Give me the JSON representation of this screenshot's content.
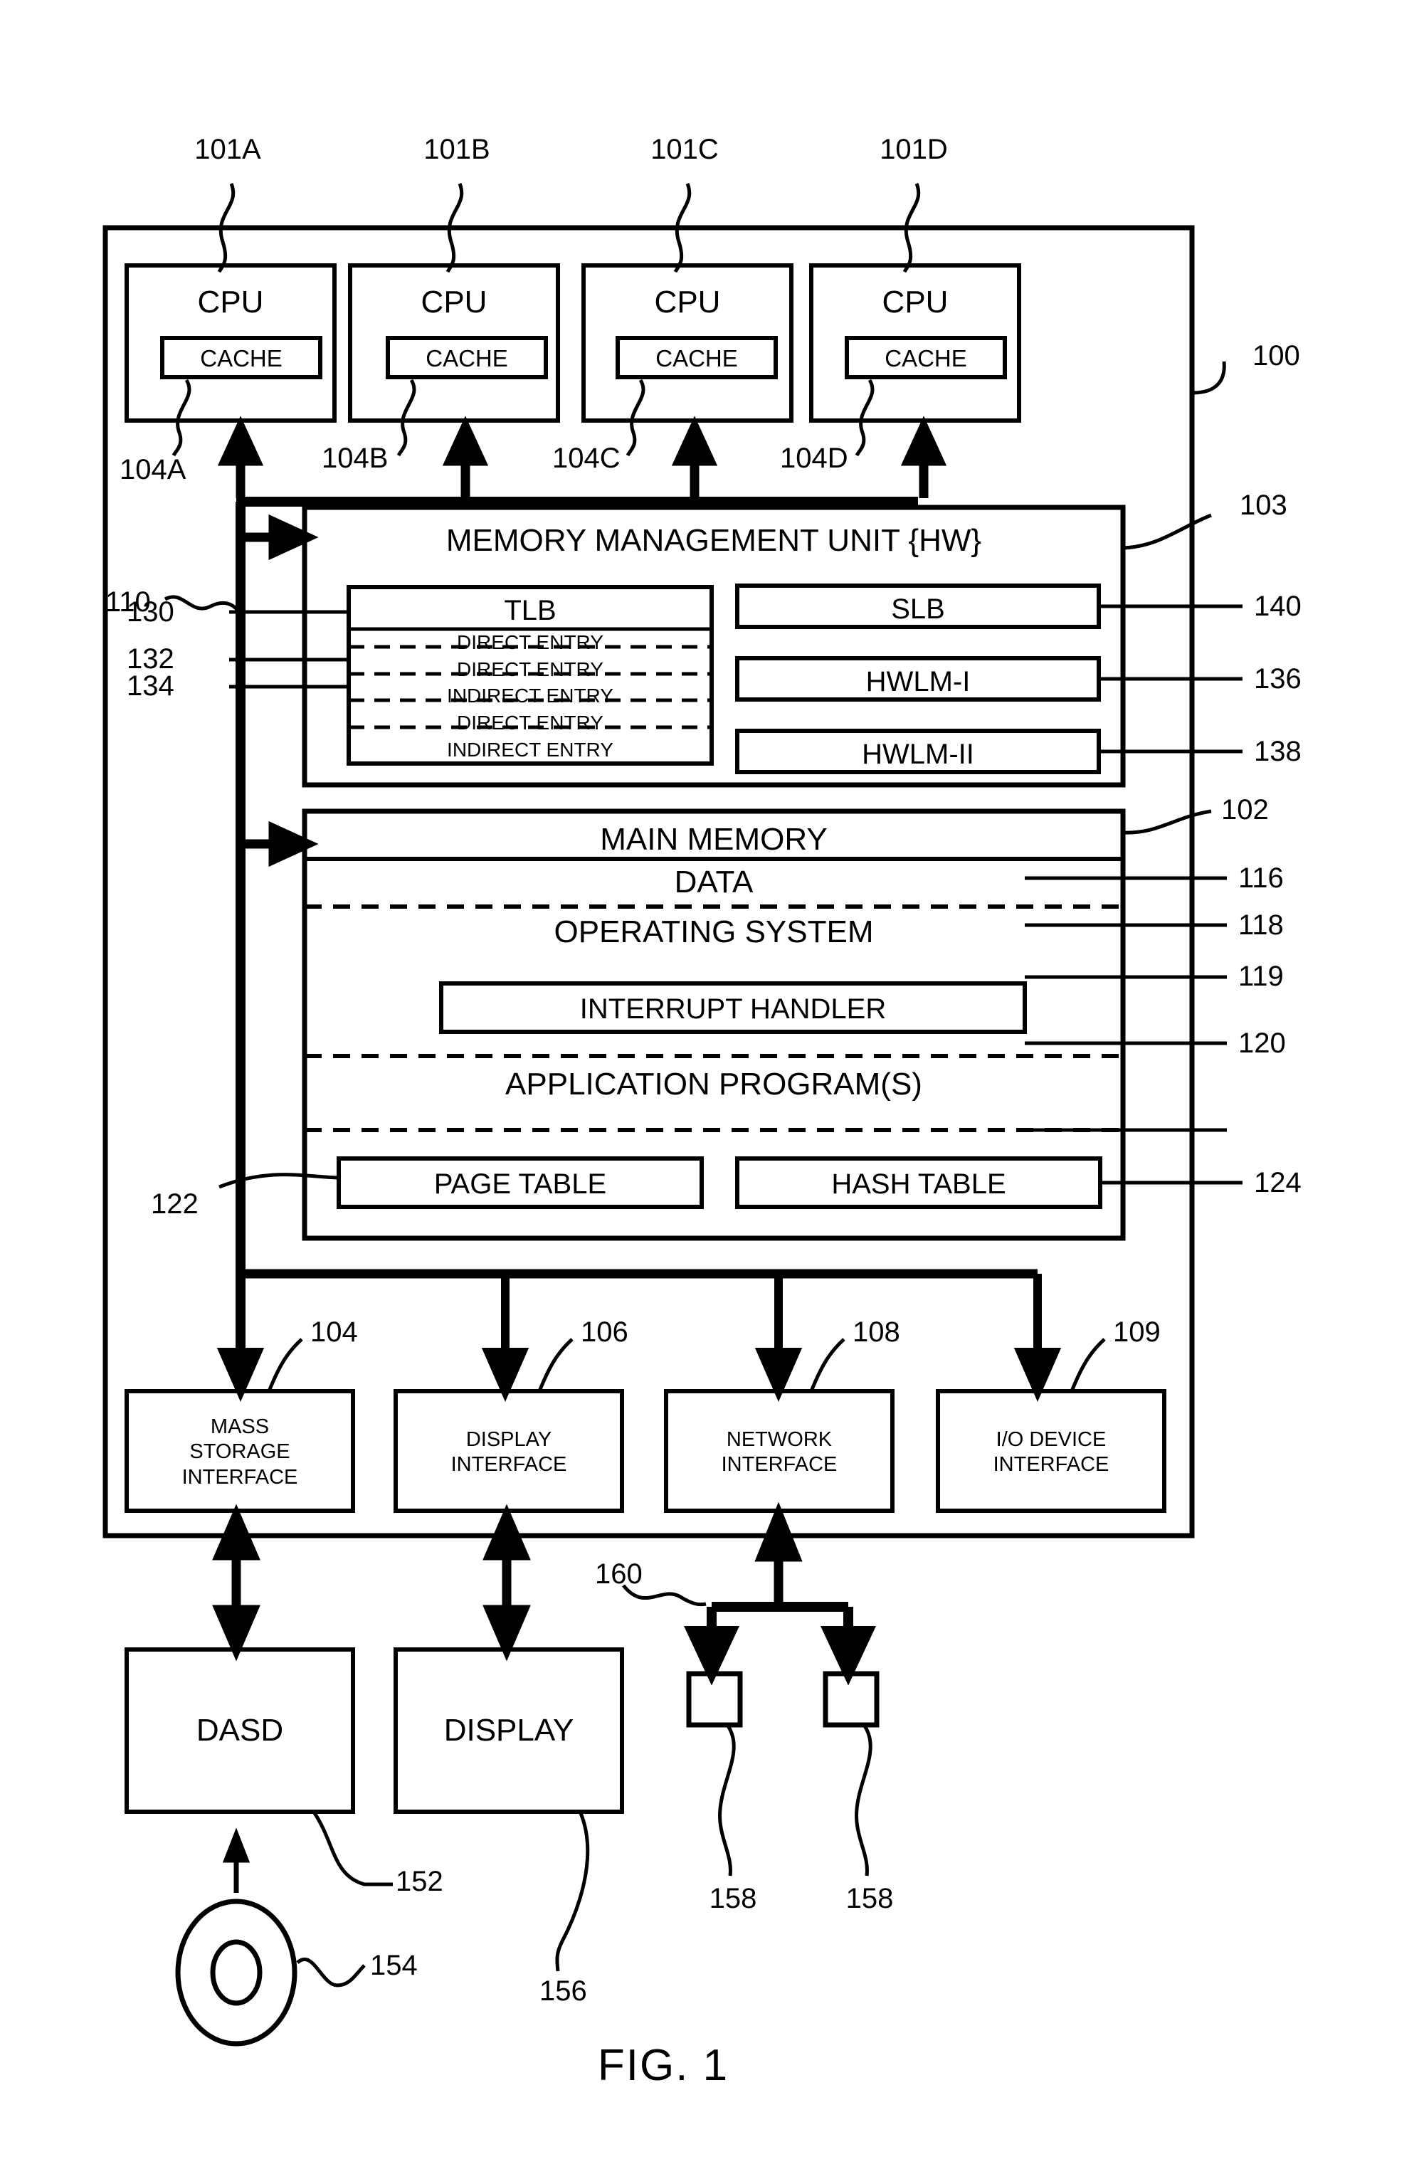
{
  "figure": {
    "caption": "FIG. 1",
    "system_ref": "100"
  },
  "processors": [
    {
      "ref": "101A",
      "label": "CPU",
      "cache_label": "CACHE",
      "cache_ref": "104A"
    },
    {
      "ref": "101B",
      "label": "CPU",
      "cache_label": "CACHE",
      "cache_ref": "104B"
    },
    {
      "ref": "101C",
      "label": "CPU",
      "cache_label": "CACHE",
      "cache_ref": "104C"
    },
    {
      "ref": "101D",
      "label": "CPU",
      "cache_label": "CACHE",
      "cache_ref": "104D"
    }
  ],
  "bus": {
    "ref": "110"
  },
  "mmu": {
    "title": "MEMORY MANAGEMENT UNIT {HW}",
    "ref": "103",
    "tlb": {
      "title": "TLB",
      "ref": "130",
      "direct_entry_ref": "132",
      "indirect_entry_ref": "134",
      "entries": [
        "DIRECT ENTRY",
        "DIRECT ENTRY",
        "INDIRECT ENTRY",
        "DIRECT ENTRY",
        "INDIRECT ENTRY"
      ]
    },
    "side_blocks": [
      {
        "label": "SLB",
        "ref": "140"
      },
      {
        "label": "HWLM-I",
        "ref": "136"
      },
      {
        "label": "HWLM-II",
        "ref": "138"
      }
    ]
  },
  "main_memory": {
    "title": "MAIN MEMORY",
    "ref": "102",
    "sections": [
      {
        "label": "DATA",
        "ref": "116"
      },
      {
        "label": "OPERATING SYSTEM",
        "ref": "118"
      },
      {
        "label": "APPLICATION PROGRAM(S)",
        "ref": "120"
      }
    ],
    "interrupt_handler": {
      "label": "INTERRUPT HANDLER",
      "ref": "119"
    },
    "tables": [
      {
        "label": "PAGE TABLE",
        "ref": "122"
      },
      {
        "label": "HASH TABLE",
        "ref": "124"
      }
    ]
  },
  "interfaces": [
    {
      "lines": [
        "MASS",
        "STORAGE",
        "INTERFACE"
      ],
      "ref": "104"
    },
    {
      "lines": [
        "DISPLAY",
        "INTERFACE"
      ],
      "ref": "106"
    },
    {
      "lines": [
        "NETWORK",
        "INTERFACE"
      ],
      "ref": "108"
    },
    {
      "lines": [
        "I/O DEVICE",
        "INTERFACE"
      ],
      "ref": "109"
    }
  ],
  "devices": [
    {
      "label": "DASD",
      "ref": "152"
    },
    {
      "label": "DISPLAY",
      "ref": "156"
    }
  ],
  "media": {
    "ref": "154"
  },
  "network": {
    "ref": "160",
    "nodes": [
      {
        "ref": "158"
      },
      {
        "ref": "158"
      }
    ]
  },
  "colors": {
    "ink": "#000000",
    "paper": "#ffffff"
  }
}
